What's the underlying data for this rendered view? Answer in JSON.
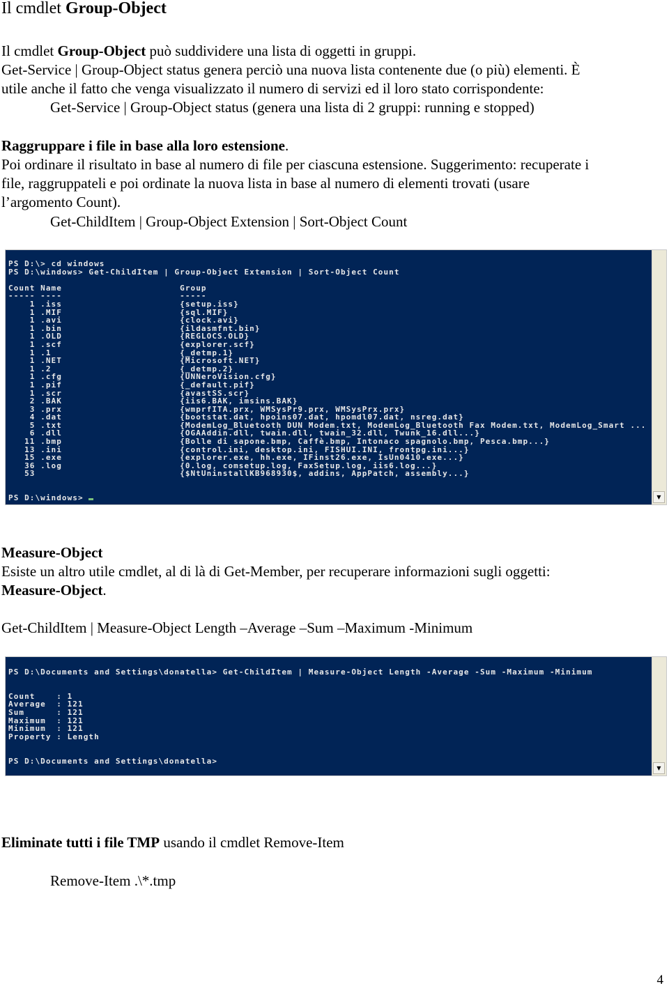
{
  "section1": {
    "title_prefix": "Il cmdlet ",
    "title_bold": "Group-Object",
    "p1_prefix": "Il cmdlet ",
    "p1_bold": "Group-Object",
    "p1_suffix": " può suddividere una lista di oggetti in gruppi.",
    "p2": "Get-Service | Group-Object status genera perciò una nuova lista contenente due (o più) elementi. È",
    "p3": "utile anche il fatto che venga visualizzato il numero di servizi ed il loro stato corrispondente:",
    "p4": "Get-Service | Group-Object status  (genera una lista di 2 gruppi: running e stopped)"
  },
  "section2": {
    "heading": "Raggruppare i file in base alla loro estensione",
    "heading_end": ".",
    "p1": "Poi ordinare il risultato in base al numero di file per ciascuna estensione. Suggerimento: recuperate i",
    "p2": "file, raggruppateli e poi ordinate la nuova lista in base al numero di elementi trovati (usare",
    "p3": "l’argomento Count).",
    "command": "Get-ChildItem | Group-Object Extension | Sort-Object Count"
  },
  "console1": {
    "lines": [
      "PS D:\\> cd windows",
      "PS D:\\windows> Get-ChildItem | Group-Object Extension | Sort-Object Count",
      "",
      "Count Name                      Group",
      "----- ----                      -----",
      "    1 .iss                      {setup.iss}",
      "    1 .MIF                      {sql.MIF}",
      "    1 .avi                      {clock.avi}",
      "    1 .bin                      {ildasmfnt.bin}",
      "    1 .OLD                      {REGLOCS.OLD}",
      "    1 .scf                      {explorer.scf}",
      "    1 .1                        {_detmp.1}",
      "    1 .NET                      {Microsoft.NET}",
      "    1 .2                        {_detmp.2}",
      "    1 .cfg                      {UNNeroVision.cfg}",
      "    1 .pif                      {_default.pif}",
      "    1 .scr                      {avastSS.scr}",
      "    2 .BAK                      {iis6.BAK, imsins.BAK}",
      "    3 .prx                      {wmprfITA.prx, WMSysPr9.prx, WMSysPrx.prx}",
      "    4 .dat                      {bootstat.dat, hpoins07.dat, hpomdl07.dat, nsreg.dat}",
      "    5 .txt                      {ModemLog_Bluetooth DUN Modem.txt, ModemLog_Bluetooth Fax Modem.txt, ModemLog_Smart ...",
      "    6 .dll                      {OGAAddin.dll, twain.dll, twain_32.dll, Twunk_16.dll...}",
      "   11 .bmp                      {Bolle di sapone.bmp, Caffè.bmp, Intonaco spagnolo.bmp, Pesca.bmp...}",
      "   13 .ini                      {control.ini, desktop.ini, FISHUI.INI, frontpg.ini...}",
      "   15 .exe                      {explorer.exe, hh.exe, IFinst26.exe, IsUn0410.exe...}",
      "   36 .log                      {0.log, comsetup.log, FaxSetup.log, iis6.log...}",
      "   53                           {$NtUninstallKB968930$, addins, AppPatch, assembly...}",
      "",
      ""
    ],
    "prompt": "PS D:\\windows> "
  },
  "section3": {
    "heading": "Measure-Object",
    "p1": "Esiste un altro utile cmdlet, al di là di Get-Member, per recuperare informazioni sugli oggetti:",
    "p2_bold": "Measure-Object",
    "p2_end": ".",
    "command": "Get-ChildItem | Measure-Object Length –Average –Sum –Maximum -Minimum"
  },
  "console2": {
    "lines": [
      "PS D:\\Documents and Settings\\donatella> Get-ChildItem | Measure-Object Length -Average -Sum -Maximum -Minimum",
      "",
      "",
      "Count    : 1",
      "Average  : 121",
      "Sum      : 121",
      "Maximum  : 121",
      "Minimum  : 121",
      "Property : Length",
      "",
      ""
    ],
    "prompt": "PS D:\\Documents and Settings\\donatella>"
  },
  "section4": {
    "heading_bold": "Eliminate tutti i file TMP",
    "heading_rest": " usando il cmdlet Remove-Item",
    "command": "Remove-Item .\\*.tmp"
  },
  "page_number": "4",
  "colors": {
    "console_bg": "#012456",
    "console_text": "#e8e8e8"
  }
}
